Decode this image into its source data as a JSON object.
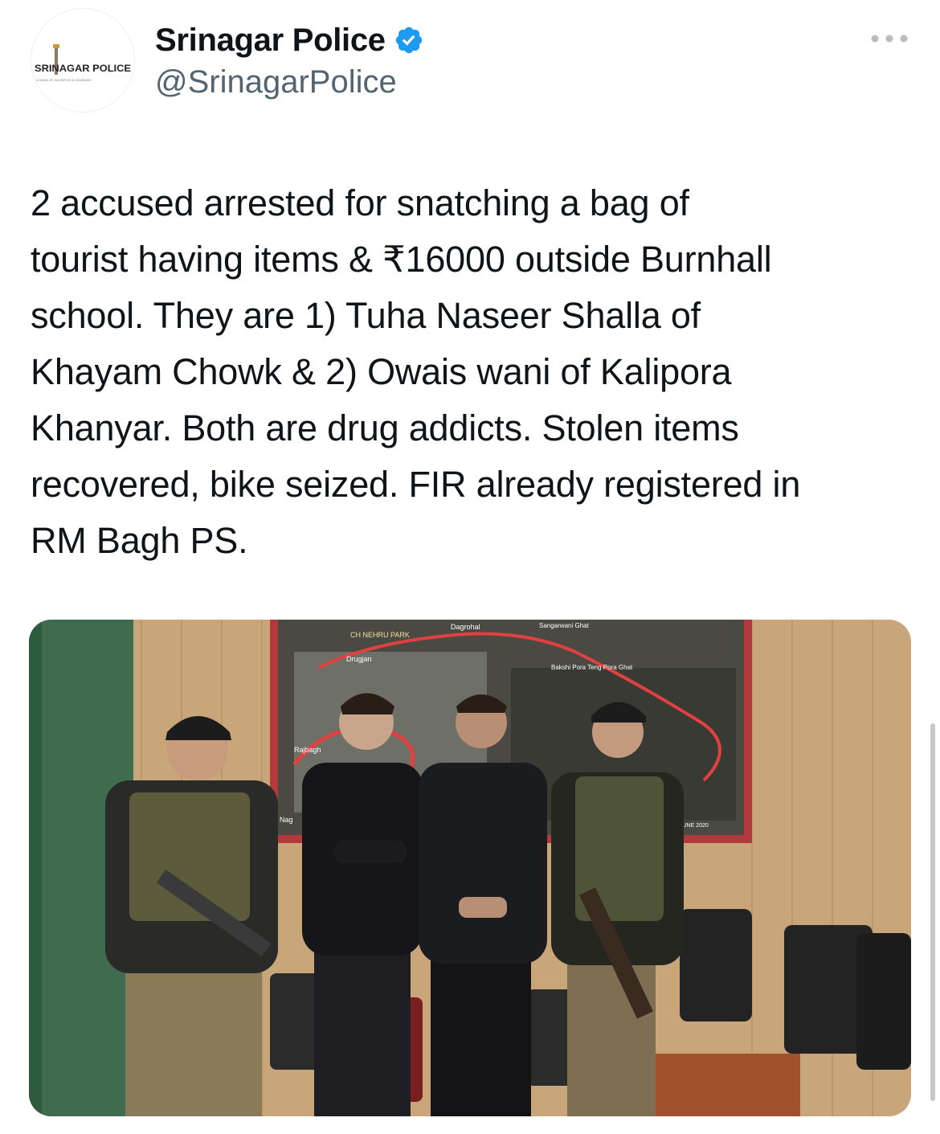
{
  "tweet": {
    "author": {
      "name": "Srinagar Police",
      "handle": "@SrinagarPolice",
      "verified": true,
      "avatar_logo_text": "SRINAGAR POLICE",
      "avatar_tagline": "A SAGA OF SACRIFICE & COURAGE"
    },
    "more_icon": "more-horizontal-icon",
    "text": "2 accused arrested for snatching a bag of\ntourist having items & ₹16000 outside Burnhall\nschool. They are 1) Tuha Naseer Shalla of\nKhayam Chowk & 2) Owais wani of  Kalipora\nKhanyar. Both are drug addicts. Stolen items\nrecovered, bike seized. FIR already registered in\nRM Bagh PS.",
    "media": {
      "type": "photo",
      "map_labels": [
        "CH NEHRU PARK",
        "Dagrohal",
        "Sangarwani Ghat",
        "Drugjan",
        "Bakshi Pora Teng Pora Ghat",
        "Rajbagh",
        "Nag",
        "JUNE 2020"
      ]
    }
  },
  "colors": {
    "text_primary": "#0f1419",
    "text_secondary": "#536471",
    "verified_blue": "#1d9bf0",
    "wall_wood": "#c9a57a",
    "map_border": "#b23a3a"
  }
}
